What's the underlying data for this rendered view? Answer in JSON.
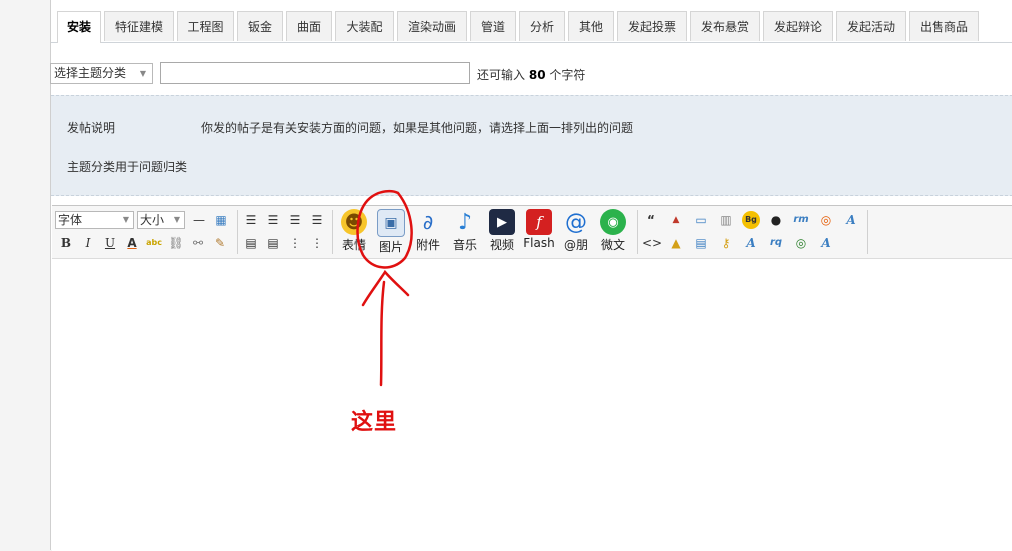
{
  "tabs": [
    "安装",
    "特征建模",
    "工程图",
    "钣金",
    "曲面",
    "大装配",
    "渲染动画",
    "管道",
    "分析",
    "其他",
    "发起投票",
    "发布悬赏",
    "发起辩论",
    "发起活动",
    "出售商品"
  ],
  "subject": {
    "category_select": "选择主题分类",
    "input_value": "",
    "hint_prefix": "还可输入",
    "hint_count": "80",
    "hint_suffix": "个字符"
  },
  "info": {
    "label": "发帖说明",
    "text": "你发的帖子是有关安装方面的问题，如果是其他问题，请选择上面一排列出的问题",
    "note": "主题分类用于问题归类"
  },
  "toolbar": {
    "font_select": "字体",
    "size_select": "大小",
    "format": {
      "bold": "B",
      "italic": "I",
      "underline": "U",
      "font_color": "A",
      "highlight": "abc"
    },
    "media": [
      {
        "label": "表情",
        "icon": "smiley-icon"
      },
      {
        "label": "图片",
        "icon": "image-icon"
      },
      {
        "label": "附件",
        "icon": "paperclip-icon"
      },
      {
        "label": "音乐",
        "icon": "music-note-icon"
      },
      {
        "label": "视频",
        "icon": "film-clapper-icon"
      },
      {
        "label": "Flash",
        "icon": "flash-icon"
      },
      {
        "label": "@朋",
        "icon": "at-sign-icon"
      },
      {
        "label": "微文",
        "icon": "wechat-icon"
      }
    ]
  },
  "annotation": {
    "text": "这里",
    "color": "#e01010"
  },
  "colors": {
    "tab_bg": "#f2f2f2",
    "info_bg": "#e7edf3",
    "annotation": "#e01010"
  }
}
